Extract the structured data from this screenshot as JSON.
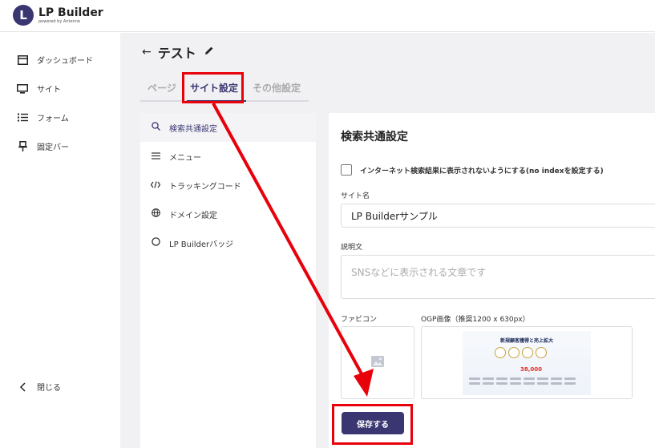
{
  "header": {
    "logo_letter": "L",
    "logo_name": "LP Builder",
    "logo_sub": "powered by Antenne"
  },
  "sidebar": {
    "items": [
      {
        "icon": "dashboard-icon",
        "label": "ダッシュボード"
      },
      {
        "icon": "monitor-icon",
        "label": "サイト"
      },
      {
        "icon": "list-icon",
        "label": "フォーム"
      },
      {
        "icon": "pin-icon",
        "label": "固定バー"
      }
    ],
    "close_label": "閉じる"
  },
  "page": {
    "back_glyph": "←",
    "title": "テスト"
  },
  "tabs": [
    {
      "label": "ページ",
      "active": false
    },
    {
      "label": "サイト設定",
      "active": true
    },
    {
      "label": "その他設定",
      "active": false
    }
  ],
  "settings_menu": [
    {
      "icon": "search-icon",
      "label": "検索共通設定",
      "active": true
    },
    {
      "icon": "menu-icon",
      "label": "メニュー",
      "active": false
    },
    {
      "icon": "code-icon",
      "label": "トラッキングコード",
      "active": false
    },
    {
      "icon": "globe-icon",
      "label": "ドメイン設定",
      "active": false
    },
    {
      "icon": "circle-icon",
      "label": "LP Builderバッジ",
      "active": false
    }
  ],
  "form": {
    "title": "検索共通設定",
    "noindex_label": "インターネット検索結果に表示されないようにする(no indexを設定する)",
    "noindex_checked": false,
    "site_name_label": "サイト名",
    "site_name_value": "LP Builderサンプル",
    "description_label": "説明文",
    "description_placeholder": "SNSなどに表示される文章です",
    "favicon_label": "ファビコン",
    "ogp_label": "OGP画像（推奨1200 x 630px）",
    "ogp_image": {
      "headline": "新規顧客獲得と売上拡大",
      "price": "38,000"
    },
    "save_label": "保存する"
  },
  "colors": {
    "accent": "#3a3672",
    "highlight": "#e8000b",
    "background": "#f1f1f4"
  }
}
